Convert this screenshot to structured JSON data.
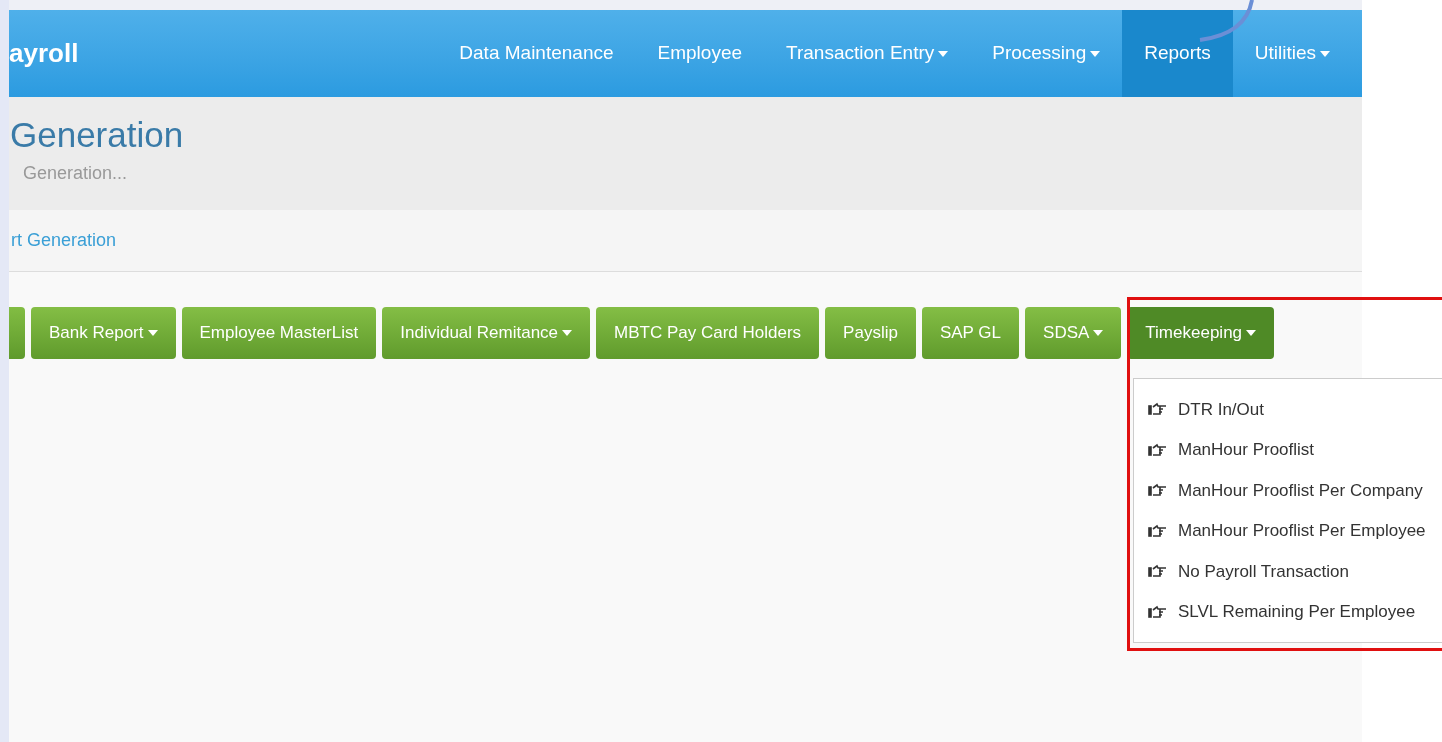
{
  "navbar": {
    "brand": "ayroll",
    "items": [
      {
        "label": "Data Maintenance",
        "dropdown": false,
        "selected": false
      },
      {
        "label": "Employee",
        "dropdown": false,
        "selected": false
      },
      {
        "label": "Transaction Entry",
        "dropdown": true,
        "selected": false
      },
      {
        "label": "Processing",
        "dropdown": true,
        "selected": false
      },
      {
        "label": "Reports",
        "dropdown": false,
        "selected": true
      },
      {
        "label": "Utilities",
        "dropdown": true,
        "selected": false
      }
    ]
  },
  "page_header": {
    "title": "Generation",
    "subtitle": "Generation..."
  },
  "breadcrumb": {
    "link": "rt Generation"
  },
  "report_buttons": [
    {
      "label": "Bank Report",
      "dropdown": true,
      "selected": false
    },
    {
      "label": "Employee MasterList",
      "dropdown": false,
      "selected": false
    },
    {
      "label": "Individual Remitance",
      "dropdown": true,
      "selected": false
    },
    {
      "label": "MBTC Pay Card Holders",
      "dropdown": false,
      "selected": false
    },
    {
      "label": "Payslip",
      "dropdown": false,
      "selected": false
    },
    {
      "label": "SAP GL",
      "dropdown": false,
      "selected": false
    },
    {
      "label": "SDSA",
      "dropdown": true,
      "selected": false
    },
    {
      "label": "Timekeeping",
      "dropdown": true,
      "selected": true
    }
  ],
  "timekeeping_menu": {
    "items": [
      "DTR In/Out",
      "ManHour Prooflist",
      "ManHour Prooflist Per Company",
      "ManHour Prooflist Per Employee",
      "No Payroll Transaction",
      "SLVL Remaining Per Employee"
    ]
  }
}
